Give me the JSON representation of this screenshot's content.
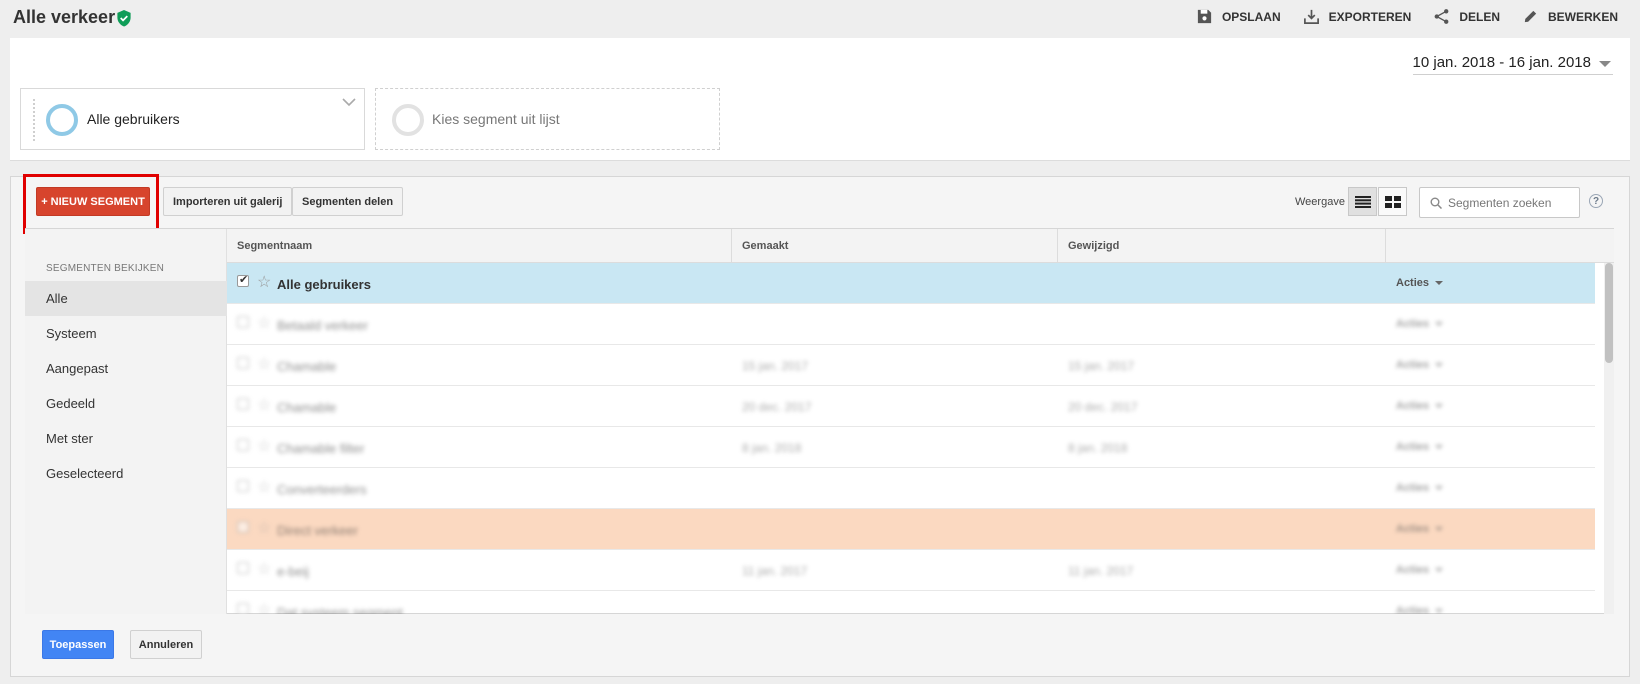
{
  "header": {
    "title": "Alle verkeer",
    "actions": [
      {
        "label": "OPSLAAN",
        "icon": "save-icon"
      },
      {
        "label": "EXPORTEREN",
        "icon": "export-icon"
      },
      {
        "label": "DELEN",
        "icon": "share-icon"
      },
      {
        "label": "BEWERKEN",
        "icon": "edit-icon"
      }
    ]
  },
  "date_range": "10 jan. 2018 - 16 jan. 2018",
  "segments": {
    "active_label": "Alle gebruikers",
    "empty_label": "Kies segment uit lijst"
  },
  "toolbar": {
    "new_segment": "+ NIEUW SEGMENT",
    "import": "Importeren uit galerij",
    "share": "Segmenten delen",
    "view_label": "Weergave",
    "search_placeholder": "Segmenten zoeken",
    "help": "?"
  },
  "sidebar": {
    "heading": "SEGMENTEN BEKIJKEN",
    "items": [
      "Alle",
      "Systeem",
      "Aangepast",
      "Gedeeld",
      "Met ster",
      "Geselecteerd"
    ],
    "active": "Alle"
  },
  "table": {
    "columns": [
      "Segmentnaam",
      "Gemaakt",
      "Gewijzigd",
      ""
    ],
    "rows": [
      {
        "name": "Alle gebruikers",
        "created": "",
        "modified": "",
        "actions": "Acties",
        "checked": true,
        "state": "selected"
      },
      {
        "name": "Betaald verkeer",
        "created": "",
        "modified": "",
        "actions": "Acties",
        "checked": false,
        "state": "blur"
      },
      {
        "name": "Chamable",
        "created": "15 jan. 2017",
        "modified": "15 jan. 2017",
        "actions": "Acties",
        "checked": false,
        "state": "blur"
      },
      {
        "name": "Chamable",
        "created": "20 dec. 2017",
        "modified": "20 dec. 2017",
        "actions": "Acties",
        "checked": false,
        "state": "blur"
      },
      {
        "name": "Chamable filter",
        "created": "8 jan. 2018",
        "modified": "8 jan. 2018",
        "actions": "Acties",
        "checked": false,
        "state": "blur"
      },
      {
        "name": "Converteerders",
        "created": "",
        "modified": "",
        "actions": "Acties",
        "checked": false,
        "state": "blur"
      },
      {
        "name": "Direct verkeer",
        "created": "",
        "modified": "",
        "actions": "Acties",
        "checked": false,
        "state": "orange"
      },
      {
        "name": "e-beij",
        "created": "11 jan. 2017",
        "modified": "11 jan. 2017",
        "actions": "Acties",
        "checked": false,
        "state": "blur"
      },
      {
        "name": "Dat systeem segment",
        "created": "",
        "modified": "",
        "actions": "Acties",
        "checked": false,
        "state": "blur"
      }
    ]
  },
  "footer": {
    "apply": "Toepassen",
    "cancel": "Annuleren"
  },
  "colors": {
    "accent_red": "#d7442d",
    "apply_blue": "#4285f4",
    "selected_row": "#c9e7f3",
    "highlight_row": "#fbd9c1",
    "verified_green": "#0f9d58"
  }
}
